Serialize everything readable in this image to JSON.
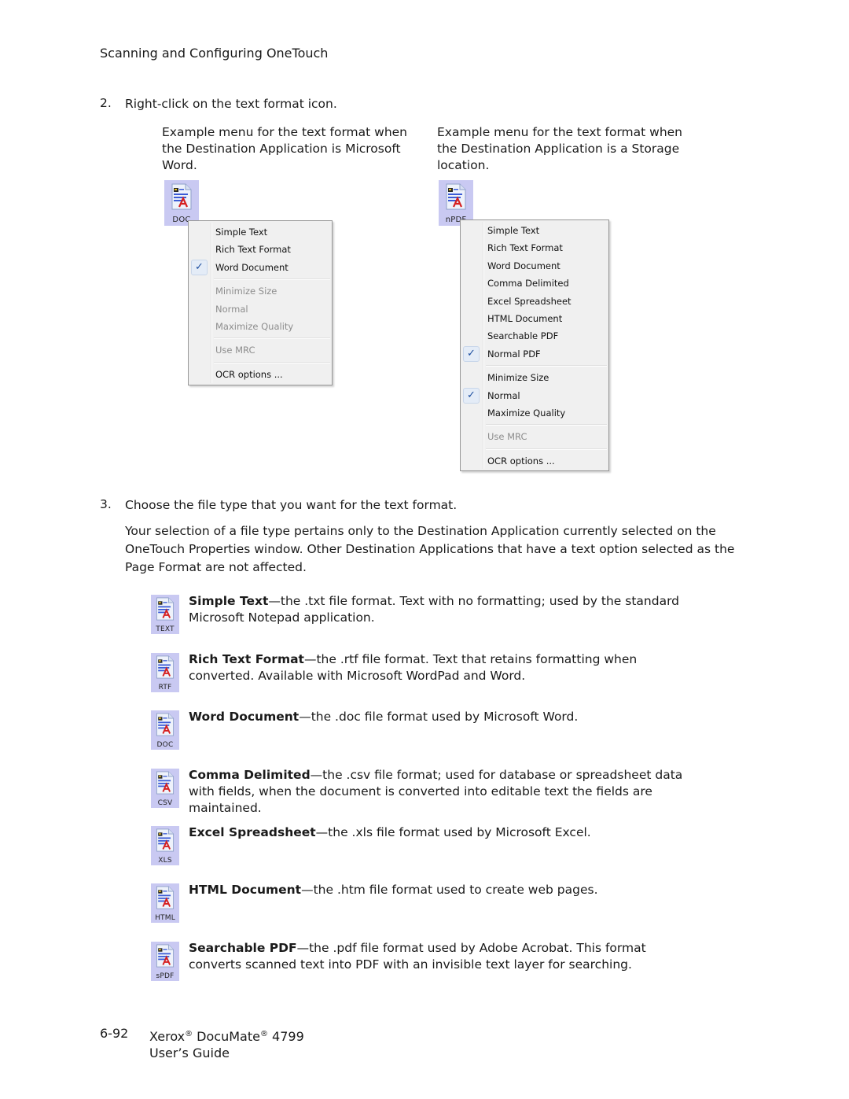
{
  "header": {
    "title": "Scanning and Configuring OneTouch"
  },
  "step2": {
    "number": "2.",
    "text": "Right-click on the text format icon.",
    "captions": [
      "Example menu for the text format when the Destination Application is Microsoft Word.",
      "Example menu for the text format when the Destination Application is a Storage location."
    ]
  },
  "menu_word": {
    "icon": {
      "label": "DOC",
      "icon_name": "text-format-file-icon"
    },
    "items": [
      {
        "label": "Simple Text",
        "checked": false,
        "disabled": false
      },
      {
        "label": "Rich Text Format",
        "checked": false,
        "disabled": false
      },
      {
        "label": "Word Document",
        "checked": true,
        "disabled": false
      },
      {
        "separator": true
      },
      {
        "label": "Minimize Size",
        "checked": false,
        "disabled": true
      },
      {
        "label": "Normal",
        "checked": false,
        "disabled": true
      },
      {
        "label": "Maximize Quality",
        "checked": false,
        "disabled": true
      },
      {
        "separator": true
      },
      {
        "label": "Use MRC",
        "checked": false,
        "disabled": true
      },
      {
        "separator": true
      },
      {
        "label": "OCR options ...",
        "checked": false,
        "disabled": false
      }
    ]
  },
  "menu_storage": {
    "icon": {
      "label": "nPDF",
      "icon_name": "text-format-file-icon"
    },
    "items": [
      {
        "label": "Simple Text",
        "checked": false,
        "disabled": false
      },
      {
        "label": "Rich Text Format",
        "checked": false,
        "disabled": false
      },
      {
        "label": "Word Document",
        "checked": false,
        "disabled": false
      },
      {
        "label": "Comma Delimited",
        "checked": false,
        "disabled": false
      },
      {
        "label": "Excel Spreadsheet",
        "checked": false,
        "disabled": false
      },
      {
        "label": "HTML Document",
        "checked": false,
        "disabled": false
      },
      {
        "label": "Searchable PDF",
        "checked": false,
        "disabled": false
      },
      {
        "label": "Normal PDF",
        "checked": true,
        "disabled": false
      },
      {
        "separator": true
      },
      {
        "label": "Minimize Size",
        "checked": false,
        "disabled": false
      },
      {
        "label": "Normal",
        "checked": true,
        "disabled": false
      },
      {
        "label": "Maximize Quality",
        "checked": false,
        "disabled": false
      },
      {
        "separator": true
      },
      {
        "label": "Use MRC",
        "checked": false,
        "disabled": true
      },
      {
        "separator": true
      },
      {
        "label": "OCR options ...",
        "checked": false,
        "disabled": false
      }
    ]
  },
  "check_glyph": "✓",
  "step3": {
    "number": "3.",
    "text": "Choose the file type that you want for the text format.",
    "note": "Your selection of a file type pertains only to the Destination Application currently selected on the OneTouch Properties window. Other Destination Applications that have a text option selected as the Page Format are not affected."
  },
  "formats": [
    {
      "icon_label": "TEXT",
      "name": "Simple Text",
      "description": "—the .txt file format. Text with no formatting; used by the standard Microsoft Notepad application."
    },
    {
      "icon_label": "RTF",
      "name": "Rich Text Format",
      "description": "—the .rtf file format. Text that retains formatting when converted. Available with Microsoft WordPad and Word."
    },
    {
      "icon_label": "DOC",
      "name": "Word Document",
      "description": "—the .doc file format used by Microsoft Word."
    },
    {
      "icon_label": "CSV",
      "name": "Comma Delimited",
      "description": "—the .csv file format; used for database or spreadsheet data with fields, when the document is converted into editable text the fields are maintained."
    },
    {
      "icon_label": "XLS",
      "name": "Excel Spreadsheet",
      "description": "—the .xls file format used by Microsoft Excel."
    },
    {
      "icon_label": "HTML",
      "name": "HTML Document",
      "description": "—the .htm file format used to create web pages."
    },
    {
      "icon_label": "sPDF",
      "name": "Searchable PDF",
      "description": "—the .pdf file format used by Adobe Acrobat. This format converts scanned text into PDF with an invisible text layer for searching."
    }
  ],
  "footer": {
    "page_number": "6-92",
    "brand": "Xerox",
    "product": "DocuMate",
    "registered": "®",
    "model": "4799",
    "guide": "User’s Guide"
  }
}
